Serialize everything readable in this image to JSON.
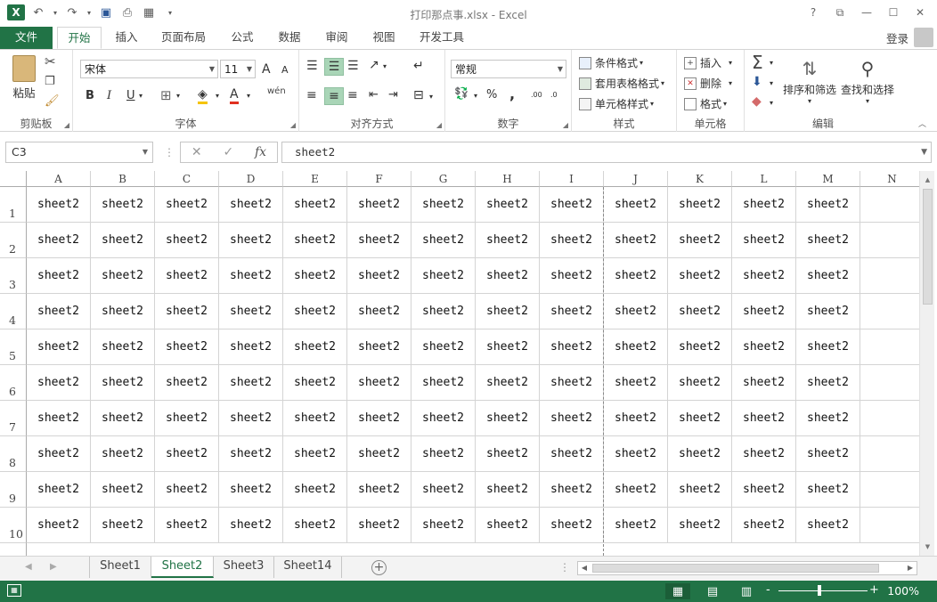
{
  "window": {
    "title": "打印那点事.xlsx - Excel",
    "app_logo": "X",
    "controls": [
      "?",
      "⧉",
      "—",
      "☐",
      "✕"
    ]
  },
  "qat": {
    "icons": [
      "undo-icon",
      "redo-icon",
      "save-icon",
      "print-preview-icon",
      "camera-icon"
    ]
  },
  "tabs": {
    "file": "文件",
    "items": [
      "开始",
      "插入",
      "页面布局",
      "公式",
      "数据",
      "审阅",
      "视图",
      "开发工具"
    ],
    "active": "开始",
    "login": "登录"
  },
  "ribbon": {
    "clipboard": {
      "label": "剪贴板",
      "paste": "粘贴"
    },
    "font": {
      "label": "字体",
      "font_name": "宋体",
      "font_size": "11",
      "bold": "B",
      "italic": "I",
      "underline": "U",
      "grow": "A",
      "shrink": "A",
      "wen": "wén",
      "font_color_letter": "A"
    },
    "alignment": {
      "label": "对齐方式"
    },
    "number": {
      "label": "数字",
      "format": "常规",
      "percent": "%",
      "comma": ",",
      "inc_decimal": ".00",
      "dec_decimal": ".0"
    },
    "styles": {
      "label": "样式",
      "conditional": "条件格式",
      "table": "套用表格格式",
      "cell": "单元格样式"
    },
    "cells": {
      "label": "单元格",
      "insert": "插入",
      "delete": "删除",
      "format": "格式"
    },
    "editing": {
      "label": "编辑",
      "sum_symbol": "Σ",
      "sort": "排序和筛选",
      "find": "查找和选择"
    }
  },
  "formula_bar": {
    "name_box": "C3",
    "cancel": "✕",
    "enter": "✓",
    "fx": "fx",
    "value": "sheet2"
  },
  "grid": {
    "columns": [
      "A",
      "B",
      "C",
      "D",
      "E",
      "F",
      "G",
      "H",
      "I",
      "J",
      "K",
      "L",
      "M",
      "N"
    ],
    "rows": [
      "1",
      "2",
      "3",
      "4",
      "5",
      "6",
      "7",
      "8",
      "9",
      "10"
    ],
    "cell_value": "sheet2",
    "filled_columns": 13
  },
  "sheets": {
    "tabs": [
      "Sheet1",
      "Sheet2",
      "Sheet3",
      "Sheet14"
    ],
    "active": "Sheet2",
    "add": "+"
  },
  "status": {
    "zoom": "100%",
    "zoom_minus": "-",
    "zoom_plus": "+"
  },
  "colors": {
    "accent": "#217346",
    "grid_line": "#d4d4d4"
  }
}
